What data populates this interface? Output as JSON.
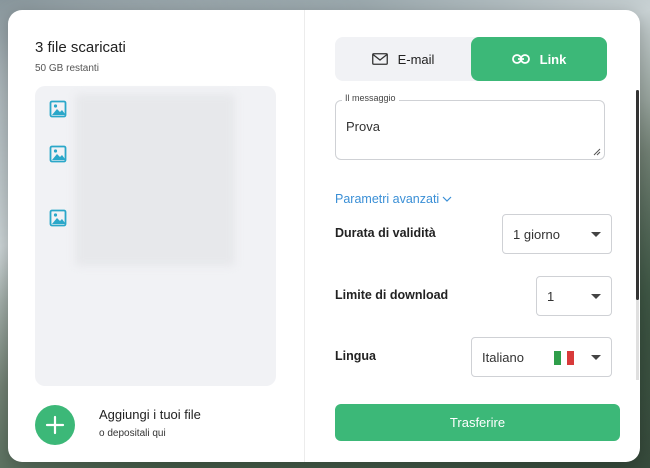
{
  "upload_panel": {
    "title": "3 file scaricati",
    "remaining": "50 GB restanti",
    "files": [
      {
        "icon": "image-file-icon"
      },
      {
        "icon": "image-file-icon"
      },
      {
        "icon": "image-file-icon"
      }
    ],
    "add_title": "Aggiungi i tuoi file",
    "add_subtitle": "o depositali qui",
    "add_icon": "plus-icon"
  },
  "mode_toggle": {
    "email_label": "E-mail",
    "email_icon": "envelope-icon",
    "link_label": "Link",
    "link_icon": "link-icon",
    "selected": "Link"
  },
  "message": {
    "label": "Il messaggio",
    "value": "Prova"
  },
  "advanced": {
    "label": "Parametri avanzati",
    "icon": "chevron-down-icon"
  },
  "settings": {
    "validity_label": "Durata di validità",
    "validity_value": "1 giorno",
    "download_limit_label": "Limite di download",
    "download_limit_value": "1",
    "language_label": "Lingua",
    "language_value": "Italiano",
    "language_flag": "italy-flag-icon"
  },
  "actions": {
    "transfer_label": "Trasferire"
  },
  "colors": {
    "accent": "#3cb878",
    "link": "#3a8fd6",
    "file_icon": "#2aa7c9"
  }
}
